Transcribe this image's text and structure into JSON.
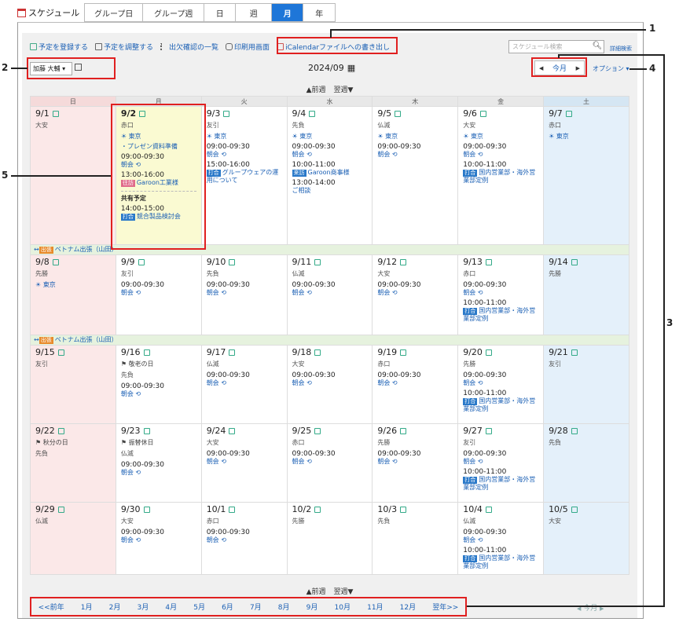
{
  "app": {
    "title": "スケジュール"
  },
  "view_tabs": [
    "グループ日",
    "グループ週",
    "日",
    "週",
    "月",
    "年"
  ],
  "toolbar": {
    "register": "予定を登録する",
    "adjust": "予定を調整する",
    "attendance": "出欠確認の一覧",
    "print": "印刷用画面",
    "ical": "iCalendarファイルへの書き出し"
  },
  "search": {
    "placeholder": "スケジュール検索",
    "advanced": "詳細検索"
  },
  "user": {
    "selected": "加藤 大輔"
  },
  "month_title": "2024/09",
  "nav": {
    "prev": "◀",
    "current": "今月",
    "next": "▶",
    "options": "オプション"
  },
  "weeknav": {
    "prev": "▲前週",
    "next": "翌週▼"
  },
  "weekdays": [
    "日",
    "月",
    "火",
    "水",
    "木",
    "金",
    "土"
  ],
  "banner": {
    "tag": "出張",
    "text": "ベトナム出張（山田）"
  },
  "weeks": [
    [
      {
        "d": "9/1",
        "rk": "大安"
      },
      {
        "d": "9/2",
        "rk": "赤口",
        "wx": "東京",
        "items": [
          {
            "l": "・プレゼン資料準備"
          },
          {
            "t": "09:00-09:30",
            "l": "朝会"
          },
          {
            "t": "13:00-16:00",
            "tag": "往訪",
            "l": "Garoon工業様"
          }
        ],
        "shared": "共有予定",
        "sitems": [
          {
            "t": "14:00-15:00",
            "tag": "打合",
            "l": "競合製品検討会"
          }
        ]
      },
      {
        "d": "9/3",
        "rk": "友引",
        "wx": "東京",
        "items": [
          {
            "t": "09:00-09:30",
            "l": "朝会"
          },
          {
            "t": "15:00-16:00",
            "tag": "打合",
            "l": "グループウェアの運用について"
          }
        ]
      },
      {
        "d": "9/4",
        "rk": "先負",
        "wx": "東京",
        "items": [
          {
            "t": "09:00-09:30",
            "l": "朝会"
          },
          {
            "t": "10:00-11:00",
            "tag": "来訪",
            "l": "Garoon商事様"
          },
          {
            "t": "13:00-14:00",
            "l": "ご相談"
          }
        ]
      },
      {
        "d": "9/5",
        "rk": "仏滅",
        "wx": "東京",
        "items": [
          {
            "t": "09:00-09:30",
            "l": "朝会"
          }
        ]
      },
      {
        "d": "9/6",
        "rk": "大安",
        "wx": "東京",
        "items": [
          {
            "t": "09:00-09:30",
            "l": "朝会"
          },
          {
            "t": "10:00-11:00",
            "tag": "打合",
            "l": "国内営業部・海外営業部定例"
          }
        ]
      },
      {
        "d": "9/7",
        "rk": "赤口",
        "wx": "東京"
      }
    ],
    [
      {
        "d": "9/8",
        "rk": "先勝",
        "wx": "東京"
      },
      {
        "d": "9/9",
        "rk": "友引",
        "items": [
          {
            "t": "09:00-09:30",
            "l": "朝会"
          }
        ]
      },
      {
        "d": "9/10",
        "rk": "先負",
        "items": [
          {
            "t": "09:00-09:30",
            "l": "朝会"
          }
        ]
      },
      {
        "d": "9/11",
        "rk": "仏滅",
        "items": [
          {
            "t": "09:00-09:30",
            "l": "朝会"
          }
        ]
      },
      {
        "d": "9/12",
        "rk": "大安",
        "items": [
          {
            "t": "09:00-09:30",
            "l": "朝会"
          }
        ]
      },
      {
        "d": "9/13",
        "rk": "赤口",
        "items": [
          {
            "t": "09:00-09:30",
            "l": "朝会"
          },
          {
            "t": "10:00-11:00",
            "tag": "打合",
            "l": "国内営業部・海外営業部定例"
          }
        ]
      },
      {
        "d": "9/14",
        "rk": "先勝"
      }
    ],
    [
      {
        "d": "9/15",
        "rk": "友引"
      },
      {
        "d": "9/16",
        "hol": "敬老の日",
        "rk": "先負",
        "items": [
          {
            "t": "09:00-09:30",
            "l": "朝会"
          }
        ]
      },
      {
        "d": "9/17",
        "rk": "仏滅",
        "items": [
          {
            "t": "09:00-09:30",
            "l": "朝会"
          }
        ]
      },
      {
        "d": "9/18",
        "rk": "大安",
        "items": [
          {
            "t": "09:00-09:30",
            "l": "朝会"
          }
        ]
      },
      {
        "d": "9/19",
        "rk": "赤口",
        "items": [
          {
            "t": "09:00-09:30",
            "l": "朝会"
          }
        ]
      },
      {
        "d": "9/20",
        "rk": "先勝",
        "items": [
          {
            "t": "09:00-09:30",
            "l": "朝会"
          },
          {
            "t": "10:00-11:00",
            "tag": "打合",
            "l": "国内営業部・海外営業部定例"
          }
        ]
      },
      {
        "d": "9/21",
        "rk": "友引"
      }
    ],
    [
      {
        "d": "9/22",
        "hol": "秋分の日",
        "rk": "先負"
      },
      {
        "d": "9/23",
        "hol": "振替休日",
        "rk": "仏滅",
        "items": [
          {
            "t": "09:00-09:30",
            "l": "朝会"
          }
        ]
      },
      {
        "d": "9/24",
        "rk": "大安",
        "items": [
          {
            "t": "09:00-09:30",
            "l": "朝会"
          }
        ]
      },
      {
        "d": "9/25",
        "rk": "赤口",
        "items": [
          {
            "t": "09:00-09:30",
            "l": "朝会"
          }
        ]
      },
      {
        "d": "9/26",
        "rk": "先勝",
        "items": [
          {
            "t": "09:00-09:30",
            "l": "朝会"
          }
        ]
      },
      {
        "d": "9/27",
        "rk": "友引",
        "items": [
          {
            "t": "09:00-09:30",
            "l": "朝会"
          },
          {
            "t": "10:00-11:00",
            "tag": "打合",
            "l": "国内営業部・海外営業部定例"
          }
        ]
      },
      {
        "d": "9/28",
        "rk": "先負"
      }
    ],
    [
      {
        "d": "9/29",
        "rk": "仏滅"
      },
      {
        "d": "9/30",
        "rk": "大安",
        "items": [
          {
            "t": "09:00-09:30",
            "l": "朝会"
          }
        ]
      },
      {
        "d": "10/1",
        "rk": "赤口",
        "items": [
          {
            "t": "09:00-09:30",
            "l": "朝会"
          }
        ]
      },
      {
        "d": "10/2",
        "rk": "先勝"
      },
      {
        "d": "10/3",
        "rk": "先負"
      },
      {
        "d": "10/4",
        "rk": "仏滅",
        "items": [
          {
            "t": "09:00-09:30",
            "l": "朝会"
          },
          {
            "t": "10:00-11:00",
            "tag": "打合",
            "l": "国内営業部・海外営業部定例"
          }
        ]
      },
      {
        "d": "10/5",
        "rk": "大安"
      }
    ]
  ],
  "month_nav": [
    "<<前年",
    "1月",
    "2月",
    "3月",
    "4月",
    "5月",
    "6月",
    "7月",
    "8月",
    "9月",
    "10月",
    "11月",
    "12月",
    "翌年>>"
  ],
  "callouts": [
    "1",
    "2",
    "3",
    "4",
    "5"
  ]
}
